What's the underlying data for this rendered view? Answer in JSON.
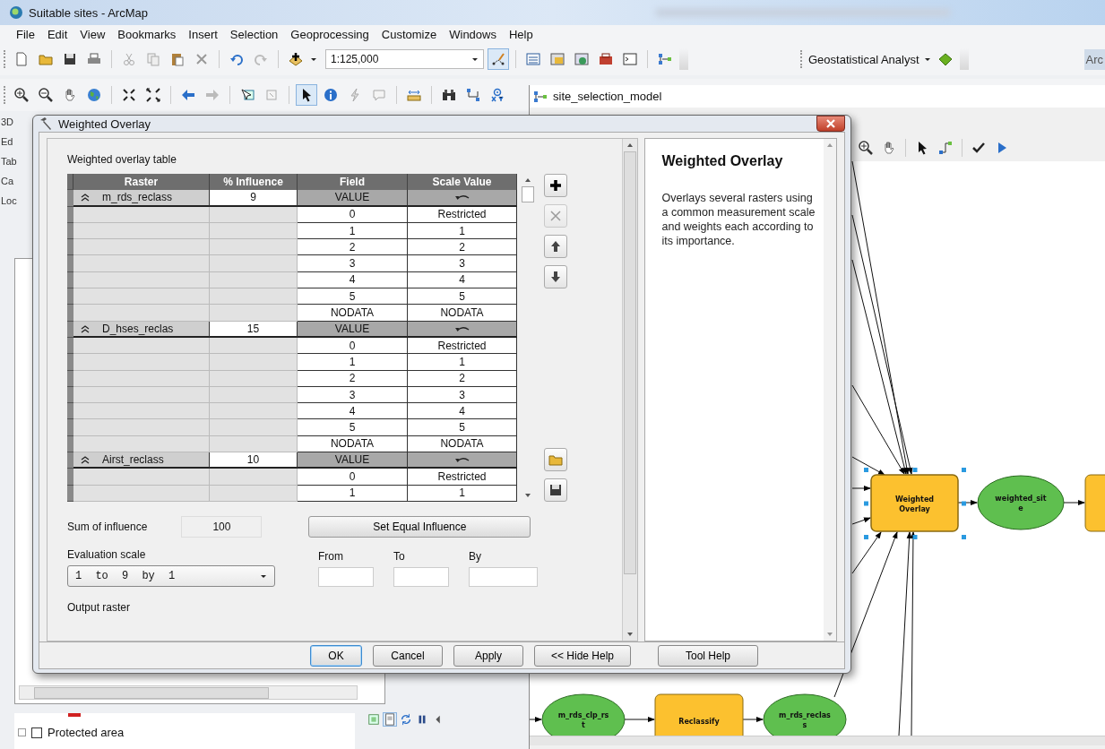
{
  "app": {
    "title": "Suitable sites - ArcMap"
  },
  "menu": [
    "File",
    "Edit",
    "View",
    "Bookmarks",
    "Insert",
    "Selection",
    "Geoprocessing",
    "Customize",
    "Windows",
    "Help"
  ],
  "toolbar": {
    "scale": "1:125,000",
    "geostat": "Geostatistical Analyst",
    "cut_label": "Arc"
  },
  "side_fragments": [
    "3D",
    "Ed",
    "Tab",
    "Ca",
    "Loc"
  ],
  "toc": {
    "layers": [
      {
        "name": "Protected area",
        "checked": false
      }
    ]
  },
  "model_window": {
    "title": "site_selection_model",
    "nodes": [
      {
        "kind": "tool",
        "label": [
          "Weighted",
          "Overlay"
        ],
        "selected": true
      },
      {
        "kind": "data",
        "label": [
          "weighted_sit",
          "e"
        ],
        "selected": false
      },
      {
        "kind": "tool",
        "selected": false
      },
      {
        "kind": "data",
        "label": [
          "m_rds_clp_rs",
          "t"
        ],
        "selected": false
      },
      {
        "kind": "tool",
        "label": [
          "Reclassify"
        ],
        "selected": false
      },
      {
        "kind": "data",
        "label": [
          "m_rds_reclas",
          "s"
        ],
        "selected": false
      }
    ]
  },
  "dialog": {
    "title": "Weighted Overlay",
    "table_label": "Weighted overlay table",
    "columns": [
      "Raster",
      "% Influence",
      "Field",
      "Scale Value"
    ],
    "groups": [
      {
        "raster": "m_rds_reclass",
        "influence": "9",
        "field": "VALUE",
        "expanded": true,
        "rows": [
          {
            "field": "0",
            "scale": "Restricted"
          },
          {
            "field": "1",
            "scale": "1"
          },
          {
            "field": "2",
            "scale": "2"
          },
          {
            "field": "3",
            "scale": "3"
          },
          {
            "field": "4",
            "scale": "4"
          },
          {
            "field": "5",
            "scale": "5"
          },
          {
            "field": "NODATA",
            "scale": "NODATA"
          }
        ]
      },
      {
        "raster": "D_hses_reclas",
        "influence": "15",
        "field": "VALUE",
        "expanded": true,
        "rows": [
          {
            "field": "0",
            "scale": "Restricted"
          },
          {
            "field": "1",
            "scale": "1"
          },
          {
            "field": "2",
            "scale": "2"
          },
          {
            "field": "3",
            "scale": "3"
          },
          {
            "field": "4",
            "scale": "4"
          },
          {
            "field": "5",
            "scale": "5"
          },
          {
            "field": "NODATA",
            "scale": "NODATA"
          }
        ]
      },
      {
        "raster": "Airst_reclass",
        "influence": "10",
        "field": "VALUE",
        "expanded": true,
        "rows": [
          {
            "field": "0",
            "scale": "Restricted"
          },
          {
            "field": "1",
            "scale": "1"
          }
        ]
      }
    ],
    "tools": [
      {
        "kind": "add",
        "disabled": false
      },
      {
        "kind": "remove",
        "disabled": true
      },
      {
        "kind": "up",
        "disabled": false
      },
      {
        "kind": "down",
        "disabled": false
      },
      {
        "kind": "open",
        "disabled": false
      },
      {
        "kind": "save",
        "disabled": false
      }
    ],
    "sum_label": "Sum of influence",
    "sum_value": "100",
    "equal_button": "Set Equal Influence",
    "scale_label": "Evaluation scale",
    "scale_value": "1 to 9 by 1",
    "range": [
      "From",
      "To",
      "By"
    ],
    "output_label": "Output raster",
    "buttons": [
      {
        "label": "OK",
        "default": true
      },
      {
        "label": "Cancel",
        "default": false
      },
      {
        "label": "Apply",
        "default": false
      },
      {
        "label": "<< Hide Help",
        "default": false
      }
    ],
    "help_button": "Tool Help",
    "help": {
      "title": "Weighted Overlay",
      "text": "Overlays several rasters using a common measurement scale and weights each according to its importance."
    }
  }
}
